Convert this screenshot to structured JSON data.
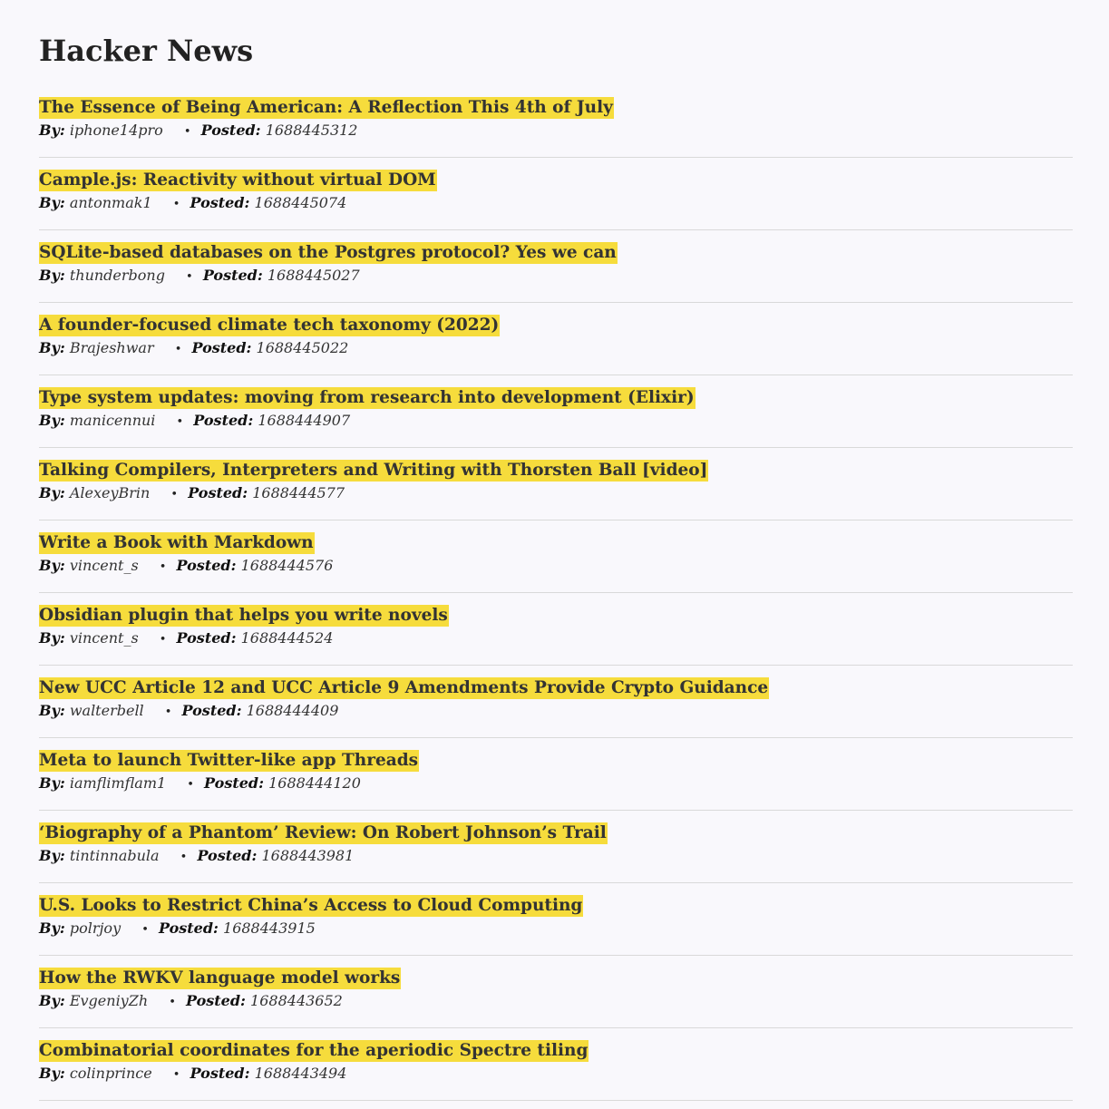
{
  "site": {
    "title": "Hacker News"
  },
  "labels": {
    "by": "By:",
    "posted": "Posted:",
    "separator": "•"
  },
  "colors": {
    "title_highlight": "#f6dc3c",
    "background": "#f9f8fc",
    "divider": "#d9d9d9"
  },
  "stories": [
    {
      "title": "The Essence of Being American: A Reflection This 4th of July",
      "by": "iphone14pro",
      "posted": "1688445312"
    },
    {
      "title": "Cample.js: Reactivity without virtual DOM",
      "by": "antonmak1",
      "posted": "1688445074"
    },
    {
      "title": "SQLite-based databases on the Postgres protocol? Yes we can",
      "by": "thunderbong",
      "posted": "1688445027"
    },
    {
      "title": "A founder-focused climate tech taxonomy (2022)",
      "by": "Brajeshwar",
      "posted": "1688445022"
    },
    {
      "title": "Type system updates: moving from research into development (Elixir)",
      "by": "manicennui",
      "posted": "1688444907"
    },
    {
      "title": "Talking Compilers, Interpreters and Writing with Thorsten Ball [video]",
      "by": "AlexeyBrin",
      "posted": "1688444577"
    },
    {
      "title": "Write a Book with Markdown",
      "by": "vincent_s",
      "posted": "1688444576"
    },
    {
      "title": "Obsidian plugin that helps you write novels",
      "by": "vincent_s",
      "posted": "1688444524"
    },
    {
      "title": "New UCC Article 12 and UCC Article 9 Amendments Provide Crypto Guidance",
      "by": "walterbell",
      "posted": "1688444409"
    },
    {
      "title": "Meta to launch Twitter-like app Threads",
      "by": "iamflimflam1",
      "posted": "1688444120"
    },
    {
      "title": "‘Biography of a Phantom’ Review: On Robert Johnson’s Trail",
      "by": "tintinnabula",
      "posted": "1688443981"
    },
    {
      "title": "U.S. Looks to Restrict China’s Access to Cloud Computing",
      "by": "polrjoy",
      "posted": "1688443915"
    },
    {
      "title": "How the RWKV language model works",
      "by": "EvgeniyZh",
      "posted": "1688443652"
    },
    {
      "title": "Combinatorial coordinates for the aperiodic Spectre tiling",
      "by": "colinprince",
      "posted": "1688443494"
    }
  ]
}
